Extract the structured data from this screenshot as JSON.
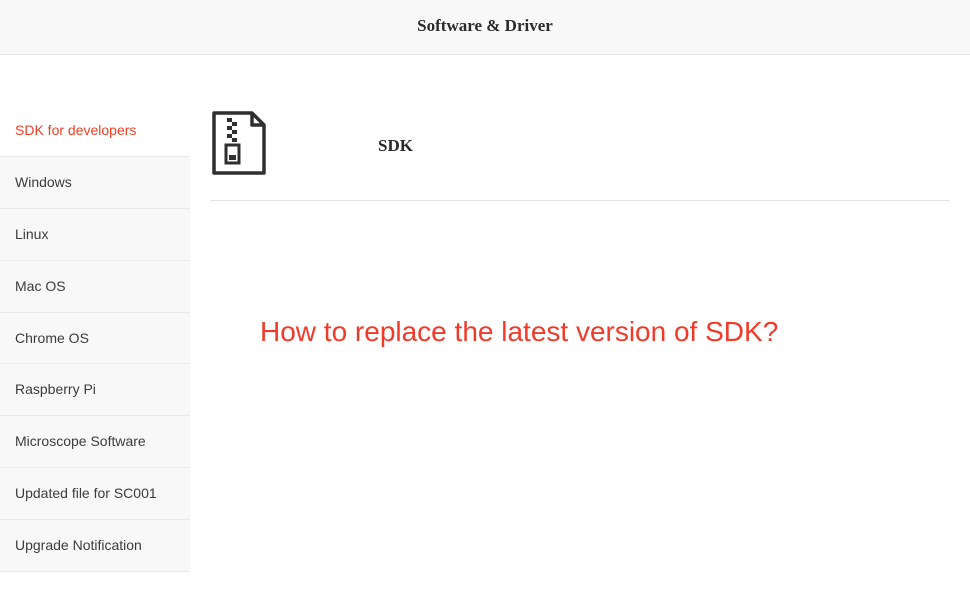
{
  "header": {
    "title": "Software & Driver"
  },
  "sidebar": {
    "items": [
      {
        "label": "SDK for developers",
        "active": true
      },
      {
        "label": "Windows",
        "active": false
      },
      {
        "label": "Linux",
        "active": false
      },
      {
        "label": "Mac OS",
        "active": false
      },
      {
        "label": "Chrome OS",
        "active": false
      },
      {
        "label": "Raspberry Pi",
        "active": false
      },
      {
        "label": "Microscope Software",
        "active": false
      },
      {
        "label": "Updated file for SC001",
        "active": false
      },
      {
        "label": "Upgrade Notification",
        "active": false
      }
    ]
  },
  "main": {
    "sdk_label": "SDK",
    "icon_name": "zip-file-icon",
    "question": "How to replace the latest version of SDK?"
  }
}
